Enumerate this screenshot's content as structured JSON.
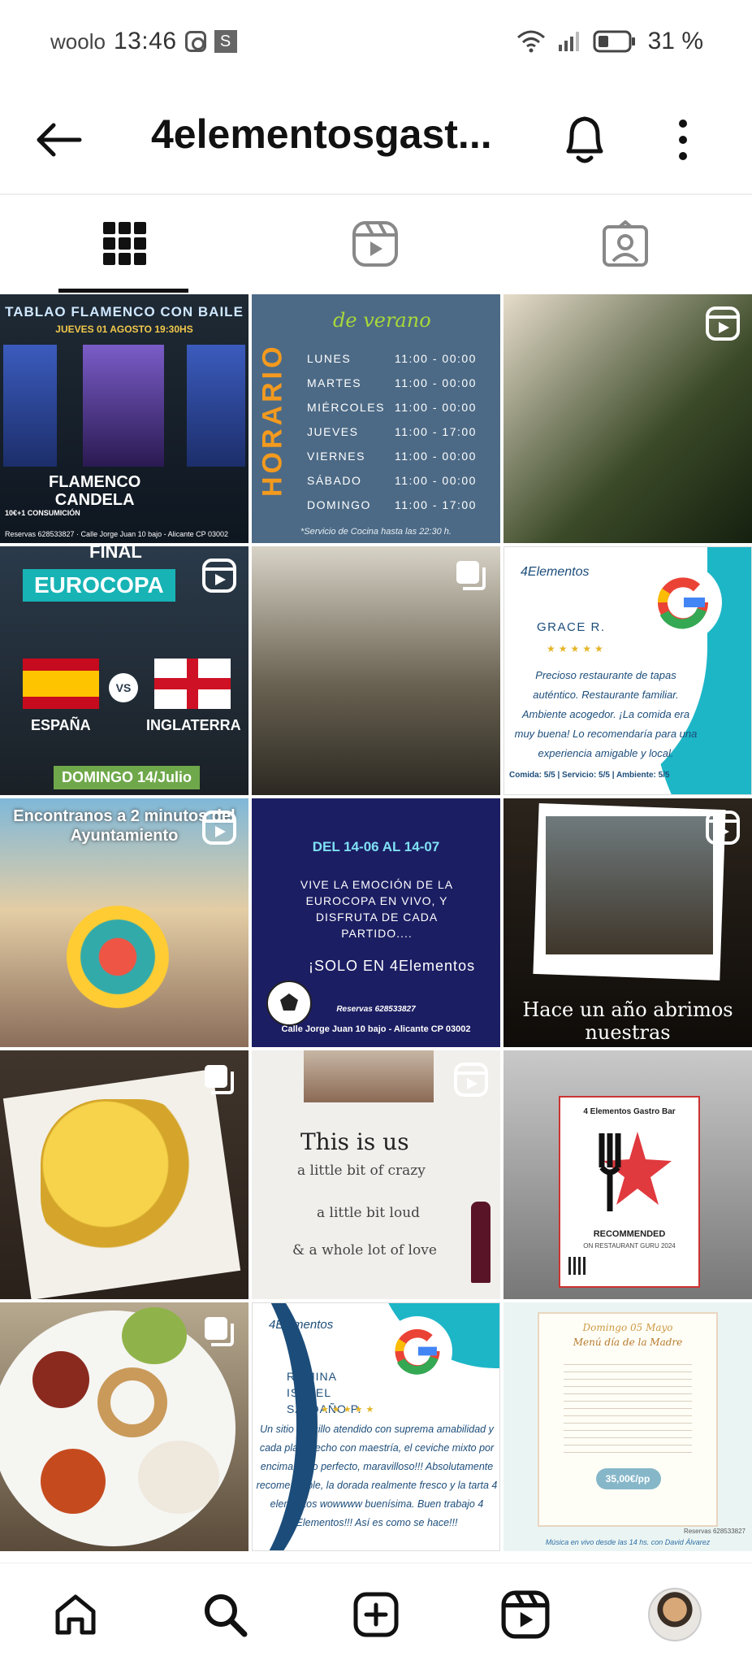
{
  "status_bar": {
    "carrier": "woolo",
    "time": "13:46",
    "battery": "31 %",
    "s_badge": "S"
  },
  "header": {
    "title": "4elementosgast..."
  },
  "tabs": [
    "grid-tab",
    "reels-tab",
    "tagged-tab"
  ],
  "posts": {
    "p1": {
      "title": "TABLAO FLAMENCO CON BAILE",
      "date": "JUEVES 01 AGOSTO 19:30HS",
      "name1": "FLAMENCO",
      "name2": "CANDELA",
      "promo": "10€+1 CONSUMICIÓN",
      "address": "Reservas 628533827 · Calle Jorge Juan 10 bajo - Alicante CP 03002"
    },
    "p2": {
      "vertical": "HORARIO",
      "script": "de verano",
      "footer": "*Servicio de Cocina hasta las 22:30 h.",
      "rows": [
        {
          "day": "LUNES",
          "hours": "11:00 - 00:00"
        },
        {
          "day": "MARTES",
          "hours": "11:00 - 00:00"
        },
        {
          "day": "MIÉRCOLES",
          "hours": "11:00 - 00:00"
        },
        {
          "day": "JUEVES",
          "hours": "11:00 - 17:00"
        },
        {
          "day": "VIERNES",
          "hours": "11:00 - 00:00"
        },
        {
          "day": "SÁBADO",
          "hours": "11:00 - 00:00"
        },
        {
          "day": "DOMINGO",
          "hours": "11:00 - 17:00"
        }
      ]
    },
    "p4": {
      "top": "FINAL",
      "event": "EUROCOPA",
      "team1": "ESPAÑA",
      "vs": "VS",
      "team2": "INGLATERRA",
      "date": "DOMINGO 14/Julio"
    },
    "p6": {
      "logo": "4Elementos",
      "reviewer": "GRACE R.",
      "stars": "★★★★★",
      "quote": "Precioso restaurante de tapas auténtico. Restaurante familiar. Ambiente acogedor. ¡La comida era muy buena! Lo recomendaría para una experiencia amigable y local.",
      "ratings": "Comida: 5/5 | Servicio: 5/5 | Ambiente: 5/5"
    },
    "p7": {
      "text": "Encontranos a 2 minutos del Ayuntamiento"
    },
    "p8": {
      "dates": "DEL 14-06 AL 14-07",
      "body": "VIVE LA EMOCIÓN DE LA EUROCOPA EN VIVO, Y DISFRUTA DE CADA PARTIDO....",
      "solo": "¡SOLO EN 4Elementos",
      "phone": "Reservas 628533827",
      "address": "Calle Jorge Juan 10 bajo - Alicante CP 03002"
    },
    "p9": {
      "text": "Hace un año abrimos nuestras"
    },
    "p11": {
      "l1": "This is us",
      "l2": "a little bit of crazy",
      "l3": "a little bit loud",
      "l4": "& a whole lot of love"
    },
    "p12": {
      "name": "4 Elementos Gastro Bar",
      "rec": "RECOMMENDED",
      "on": "ON RESTAURANT GURU 2024"
    },
    "p14": {
      "logo": "4Elementos",
      "reviewer": "ROMINA ISABEL SALDAÑO P.",
      "stars": "★★★★★",
      "quote": "Un sitio sencillo atendido con suprema amabilidad y cada plato hecho con maestría, el ceviche mixto por encima de lo perfecto, maravilloso!!! Absolutamente recomendable, la dorada realmente fresco y la tarta 4 elementos wowwww buenísima. Buen trabajo 4 Elementos!!! Así es como se hace!!!"
    },
    "p15": {
      "date": "Domingo 05 Mayo",
      "menu": "Menú día de la Madre",
      "price": "35,00€/pp",
      "footer": "Música en vivo desde las 14 hs. con David Álvarez",
      "res": "Reservas 628533827"
    }
  },
  "colors": {
    "accent_teal": "#1db6c7",
    "navy": "#1c4d7a",
    "eurocopa_bg": "#1c1e63",
    "horario_orange": "#f39a1e"
  },
  "bottom_nav": [
    "home-icon",
    "search-icon",
    "create-icon",
    "reels-icon",
    "profile-avatar"
  ]
}
